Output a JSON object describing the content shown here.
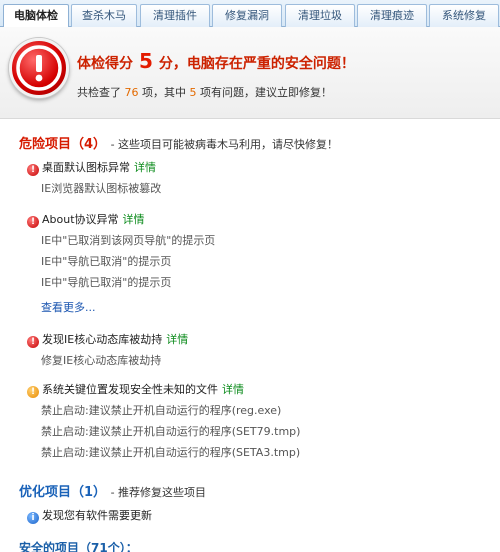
{
  "tabs": [
    {
      "label": "电脑体检",
      "active": true
    },
    {
      "label": "查杀木马",
      "active": false
    },
    {
      "label": "清理插件",
      "active": false
    },
    {
      "label": "修复漏洞",
      "active": false
    },
    {
      "label": "清理垃圾",
      "active": false
    },
    {
      "label": "清理痕迹",
      "active": false
    },
    {
      "label": "系统修复",
      "active": false
    }
  ],
  "header": {
    "score_prefix": "体检得分",
    "score": "5",
    "score_suffix": "分，电脑存在严重的安全问题！",
    "checked_prefix": "共检查了",
    "checked_count": "76",
    "checked_mid": "项，其中",
    "problem_count": "5",
    "checked_suffix": "项有问题，建议立即修复！"
  },
  "danger": {
    "title": "危险项目（4）",
    "desc": "- 这些项目可能被病毒木马利用，请尽快修复！",
    "items": [
      {
        "label": "桌面默认图标异常",
        "detail": "详情",
        "subs": [
          "IE浏览器默认图标被篡改"
        ]
      },
      {
        "label": "About协议异常",
        "detail": "详情",
        "subs": [
          "IE中\"已取消到该网页导航\"的提示页",
          "IE中\"导航已取消\"的提示页",
          "IE中\"导航已取消\"的提示页"
        ],
        "more": "查看更多..."
      },
      {
        "label": "发现IE核心动态库被劫持",
        "detail": "详情",
        "subs": [
          "修复IE核心动态库被劫持"
        ]
      },
      {
        "label": "系统关键位置发现安全性未知的文件",
        "detail": "详情",
        "subs": [
          "禁止启动:建议禁止开机自动运行的程序(reg.exe)",
          "禁止启动:建议禁止开机自动运行的程序(SET79.tmp)",
          "禁止启动:建议禁止开机自动运行的程序(SETA3.tmp)"
        ]
      }
    ]
  },
  "optimize": {
    "title": "优化项目（1）",
    "desc": "- 推荐修复这些项目",
    "items": [
      {
        "label": "发现您有软件需要更新"
      }
    ]
  },
  "safe": {
    "title": "安全的项目（71个）："
  },
  "colors": {
    "danger": "#d61a00",
    "detail": "#0a8a1a",
    "link": "#1a55b0",
    "accent_number": "#e36a00"
  }
}
